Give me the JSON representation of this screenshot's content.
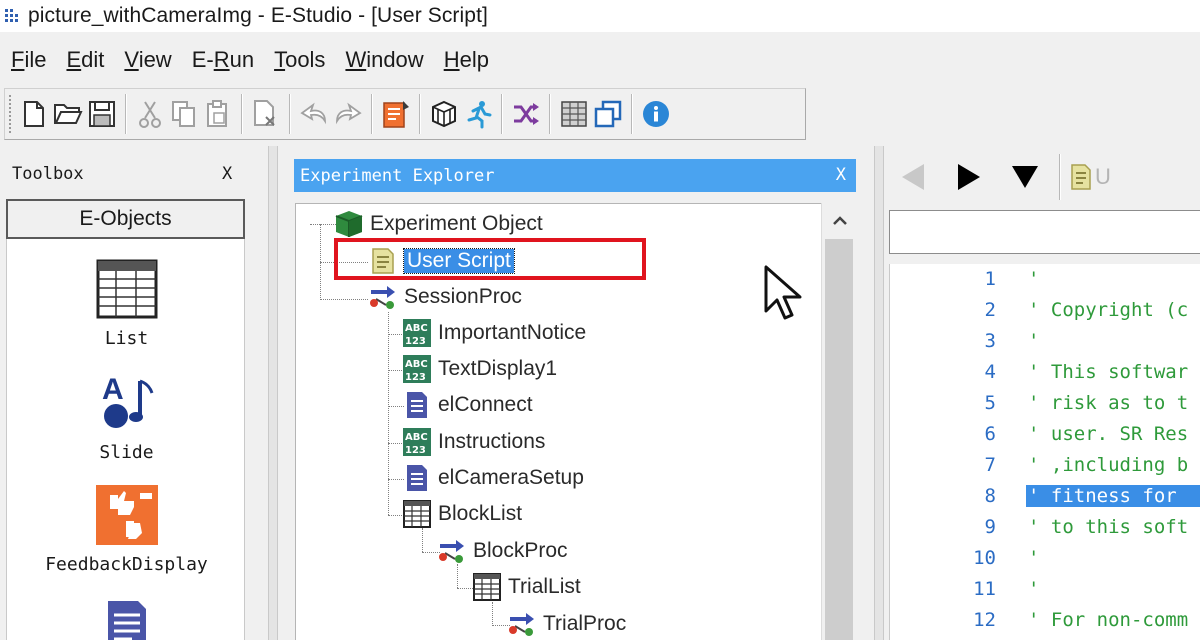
{
  "window": {
    "title": "picture_withCameraImg - E-Studio - [User Script]"
  },
  "menu": {
    "items": [
      {
        "key": "F",
        "rest": "ile"
      },
      {
        "key": "E",
        "rest": "dit"
      },
      {
        "key": "V",
        "rest": "iew"
      },
      {
        "pre": "E-",
        "key": "R",
        "rest": "un"
      },
      {
        "key": "T",
        "rest": "ools"
      },
      {
        "key": "W",
        "rest": "indow"
      },
      {
        "key": "H",
        "rest": "elp"
      }
    ]
  },
  "toolbox": {
    "title": "Toolbox",
    "close_label": "X",
    "tab_label": "E-Objects",
    "tools": [
      {
        "label": "List",
        "icon": "list-icon"
      },
      {
        "label": "Slide",
        "icon": "slide-icon"
      },
      {
        "label": "FeedbackDisplay",
        "icon": "feedback-display-icon"
      },
      {
        "label": "",
        "icon": "inline-script-icon"
      }
    ]
  },
  "explorer": {
    "title": "Experiment Explorer",
    "close_label": "X",
    "scroll_up": "^",
    "tree": [
      {
        "label": "Experiment Object",
        "icon": "experiment-cube-icon",
        "selected": false
      },
      {
        "label": "User Script",
        "icon": "script-icon",
        "selected": true
      },
      {
        "label": "SessionProc",
        "icon": "procedure-icon",
        "selected": false
      },
      {
        "label": "ImportantNotice",
        "icon": "text-display-icon",
        "selected": false
      },
      {
        "label": "TextDisplay1",
        "icon": "text-display-icon",
        "selected": false
      },
      {
        "label": "elConnect",
        "icon": "inline-script-icon",
        "selected": false
      },
      {
        "label": "Instructions",
        "icon": "text-display-icon",
        "selected": false
      },
      {
        "label": "elCameraSetup",
        "icon": "inline-script-icon",
        "selected": false
      },
      {
        "label": "BlockList",
        "icon": "list-icon",
        "selected": false
      },
      {
        "label": "BlockProc",
        "icon": "procedure-icon",
        "selected": false
      },
      {
        "label": "TrialList",
        "icon": "list-icon",
        "selected": false
      },
      {
        "label": "TrialProc",
        "icon": "procedure-icon",
        "selected": false
      }
    ]
  },
  "editor": {
    "nav": {
      "doc_label": "U"
    },
    "lines": [
      {
        "num": "1",
        "text": "'"
      },
      {
        "num": "2",
        "text": "' Copyright (c"
      },
      {
        "num": "3",
        "text": "'"
      },
      {
        "num": "4",
        "text": "' This softwar"
      },
      {
        "num": "5",
        "text": "' risk as to t"
      },
      {
        "num": "6",
        "text": "' user. SR Res"
      },
      {
        "num": "7",
        "text": "' ,including b"
      },
      {
        "num": "8",
        "text": "' fitness for"
      },
      {
        "num": "9",
        "text": "' to this soft"
      },
      {
        "num": "10",
        "text": "'"
      },
      {
        "num": "11",
        "text": "'"
      },
      {
        "num": "12",
        "text": "' For non-comm"
      }
    ],
    "highlighted_line": "8"
  },
  "colors": {
    "panel_header": "#4aa3f0",
    "selection": "#3a8ee6",
    "highlight_box": "#e0141e",
    "comment": "#2e9a3a",
    "line_number": "#2b6cc4"
  }
}
